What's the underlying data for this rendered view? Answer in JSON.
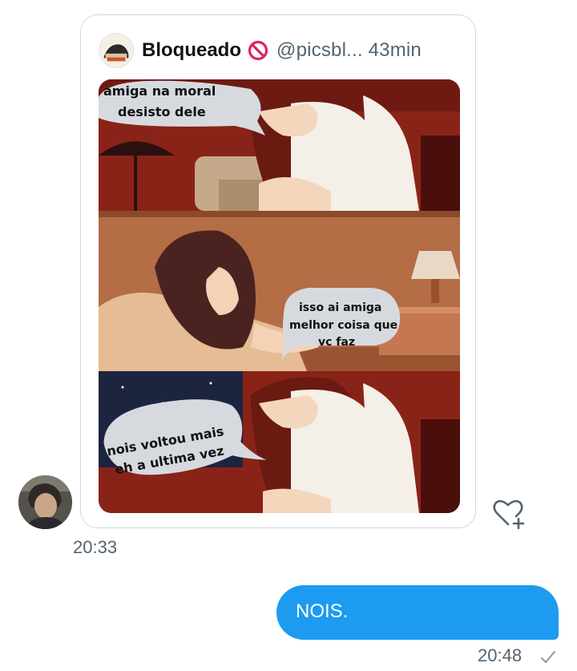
{
  "tweet": {
    "author_name": "Bloqueado",
    "handle": "@picsbl...",
    "time_ago": "43min",
    "meme_text": {
      "bubble1_line1": "amiga na moral",
      "bubble1_line2": "desisto dele",
      "bubble2_line1": "isso ai amiga",
      "bubble2_line2": "melhor coisa que",
      "bubble2_line3": "vc faz",
      "bubble3_line1": "nois voltou mais",
      "bubble3_line2": "eh a ultima vez"
    }
  },
  "received": {
    "time": "20:33"
  },
  "sent": {
    "text": "NOIS.",
    "time": "20:48"
  },
  "icons": {
    "blocked": "prohibited-icon",
    "react": "heart-plus-icon",
    "status": "checkmark-icon"
  },
  "colors": {
    "accent": "#1d9bf0",
    "blocked_red": "#e0245e",
    "muted_text": "#536471"
  }
}
